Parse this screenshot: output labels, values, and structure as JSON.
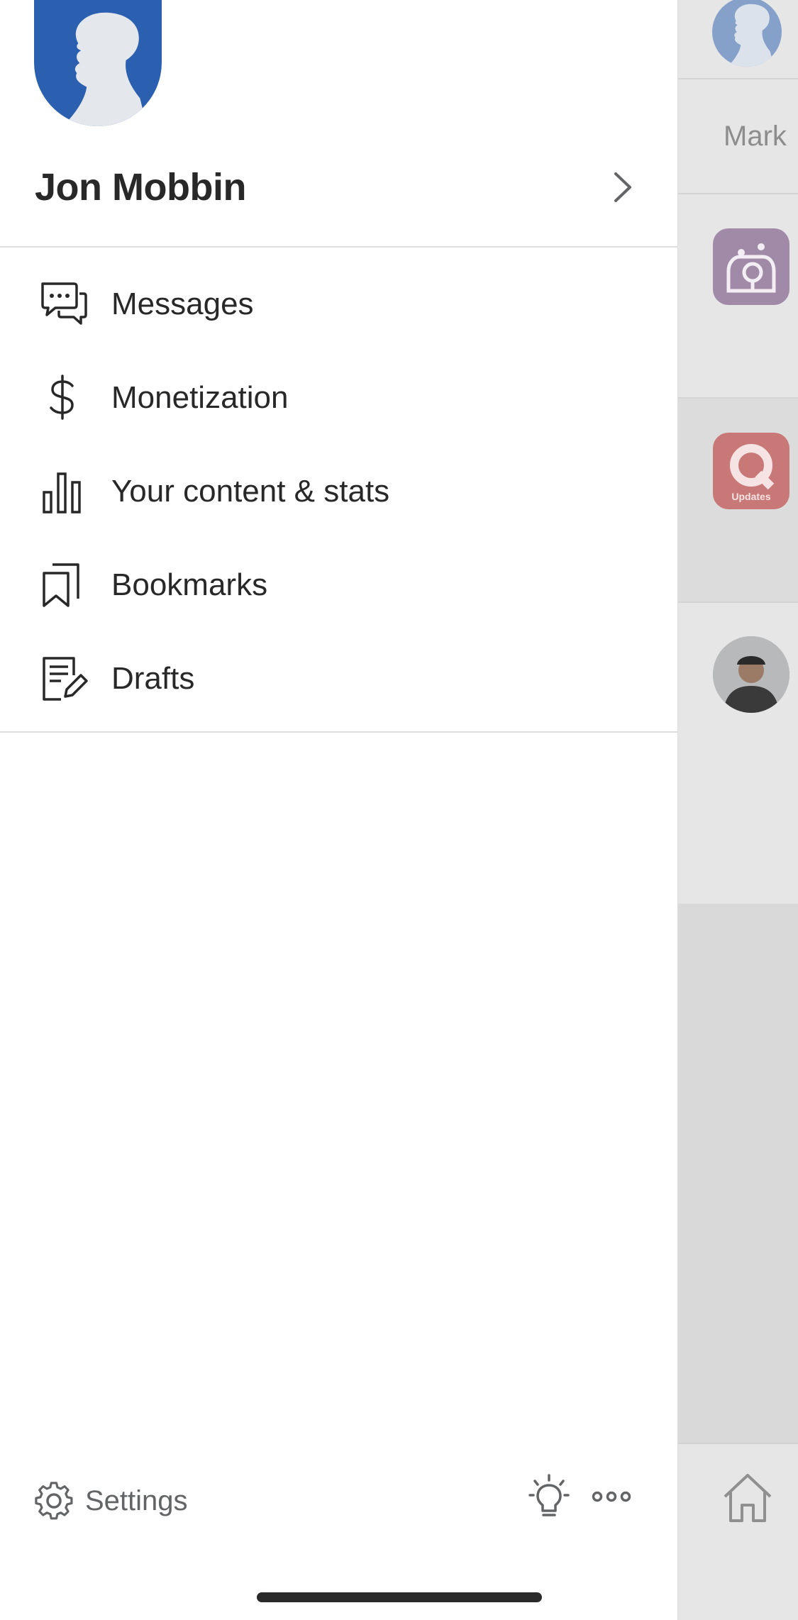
{
  "profile": {
    "name": "Jon Mobbin",
    "avatar_icon": "default-profile-silhouette",
    "chevron_icon": "chevron-right-icon"
  },
  "menu": {
    "items": [
      {
        "label": "Messages",
        "icon": "messages-icon"
      },
      {
        "label": "Monetization",
        "icon": "dollar-icon"
      },
      {
        "label": "Your content & stats",
        "icon": "bar-chart-icon"
      },
      {
        "label": "Bookmarks",
        "icon": "bookmark-icon"
      },
      {
        "label": "Drafts",
        "icon": "drafts-icon"
      }
    ]
  },
  "footer": {
    "settings_label": "Settings",
    "settings_icon": "gear-icon",
    "bulb_icon": "lightbulb-icon",
    "more_icon": "more-dots-icon"
  },
  "background": {
    "partial_name": "Mark",
    "updates_label": "Updates",
    "home_icon": "home-icon"
  },
  "colors": {
    "brand_blue": "#2b5faf",
    "text_primary": "#282829",
    "text_secondary": "#636466",
    "divider": "#dedede",
    "overlay_bg": "#e6e6e6"
  }
}
